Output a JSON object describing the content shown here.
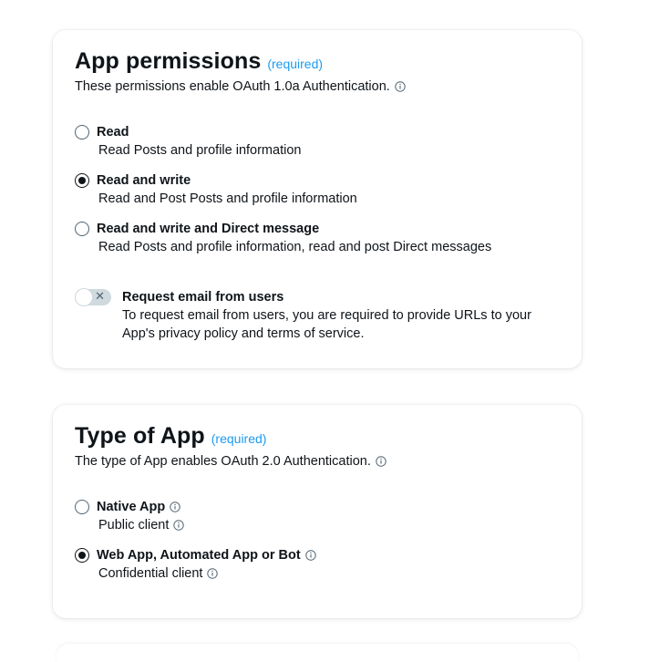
{
  "permissions": {
    "title": "App permissions",
    "required": "(required)",
    "subtitle": "These permissions enable OAuth 1.0a Authentication.",
    "options": [
      {
        "label": "Read",
        "description": "Read Posts and profile information",
        "selected": false
      },
      {
        "label": "Read and write",
        "description": "Read and Post Posts and profile information",
        "selected": true
      },
      {
        "label": "Read and write and Direct message",
        "description": "Read Posts and profile information, read and post Direct messages",
        "selected": false
      }
    ],
    "email_toggle": {
      "label": "Request email from users",
      "description": "To request email from users, you are required to provide URLs to your App's privacy policy and terms of service.",
      "enabled": false,
      "icon": "x-icon"
    }
  },
  "app_type": {
    "title": "Type of App",
    "required": "(required)",
    "subtitle": "The type of App enables OAuth 2.0 Authentication.",
    "options": [
      {
        "label": "Native App",
        "description": "Public client",
        "selected": false
      },
      {
        "label": "Web App, Automated App or Bot",
        "description": "Confidential client",
        "selected": true
      }
    ]
  },
  "colors": {
    "accent": "#1d9bf0",
    "text": "#0f1419",
    "muted": "#536471",
    "toggle_off": "#cfd9de"
  }
}
